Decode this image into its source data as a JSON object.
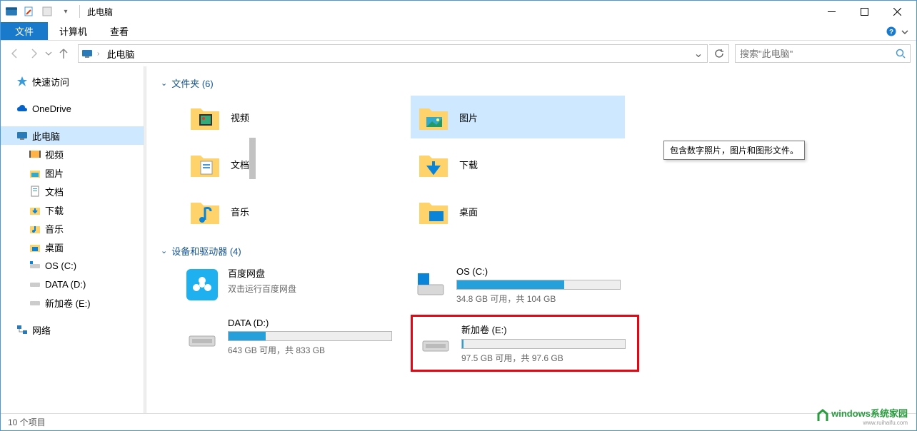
{
  "window": {
    "title": "此电脑"
  },
  "ribbon": {
    "file": "文件",
    "tabs": [
      "计算机",
      "查看"
    ]
  },
  "nav": {
    "breadcrumb": "此电脑",
    "search_placeholder": "搜索\"此电脑\""
  },
  "sidebar": {
    "quick_access": "快速访问",
    "onedrive": "OneDrive",
    "this_pc": "此电脑",
    "children": [
      {
        "label": "视频"
      },
      {
        "label": "图片"
      },
      {
        "label": "文档"
      },
      {
        "label": "下载"
      },
      {
        "label": "音乐"
      },
      {
        "label": "桌面"
      },
      {
        "label": "OS (C:)"
      },
      {
        "label": "DATA (D:)"
      },
      {
        "label": "新加卷 (E:)"
      }
    ],
    "network": "网络"
  },
  "groups": {
    "folders": {
      "header": "文件夹 (6)",
      "items": [
        "视频",
        "图片",
        "文档",
        "下载",
        "音乐",
        "桌面"
      ]
    },
    "drives": {
      "header": "设备和驱动器 (4)",
      "baidu": {
        "name": "百度网盘",
        "sub": "双击运行百度网盘"
      },
      "os": {
        "name": "OS (C:)",
        "stat": "34.8 GB 可用，共 104 GB",
        "used_pct": 66
      },
      "data": {
        "name": "DATA (D:)",
        "stat": "643 GB 可用，共 833 GB",
        "used_pct": 23
      },
      "new": {
        "name": "新加卷 (E:)",
        "stat": "97.5 GB 可用，共 97.6 GB",
        "used_pct": 1
      }
    }
  },
  "tooltip": "包含数字照片，图片和图形文件。",
  "status": "10 个项目",
  "watermark": {
    "main": "windows系统家园",
    "sub": "www.ruihaifu.com"
  }
}
